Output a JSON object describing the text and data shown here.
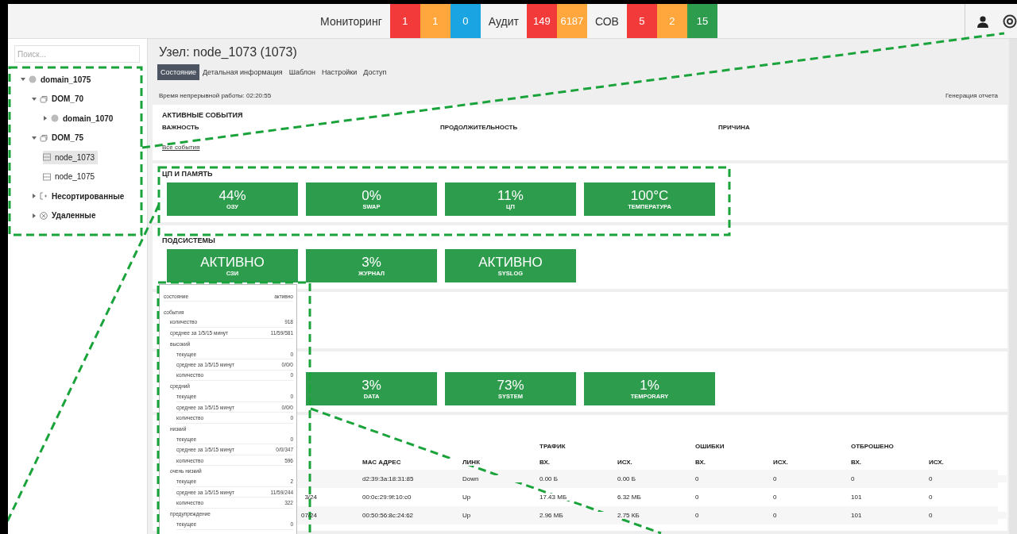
{
  "topbar": {
    "groups": [
      {
        "label": "Мониторинг",
        "counters": [
          {
            "value": "1",
            "color": "#f23a3a"
          },
          {
            "value": "1",
            "color": "#ffa63c"
          },
          {
            "value": "0",
            "color": "#1ba4e2"
          }
        ]
      },
      {
        "label": "Аудит",
        "counters": [
          {
            "value": "149",
            "color": "#f23a3a"
          },
          {
            "value": "6187",
            "color": "#ffa63c"
          }
        ]
      },
      {
        "label": "СОВ",
        "counters": [
          {
            "value": "5",
            "color": "#f23a3a"
          },
          {
            "value": "2",
            "color": "#ffa63c"
          },
          {
            "value": "15",
            "color": "#2e9c4d"
          }
        ]
      }
    ]
  },
  "sidebar": {
    "search": {
      "placeholder": "Поиск..."
    },
    "tree": [
      {
        "label": "domain_1075",
        "kind": "domain",
        "expanded": true,
        "selected": false,
        "children": [
          {
            "label": "DOM_70",
            "kind": "group",
            "expanded": true,
            "selected": false,
            "children": [
              {
                "label": "domain_1070",
                "kind": "domain",
                "expanded": false,
                "selected": false
              }
            ]
          },
          {
            "label": "DOM_75",
            "kind": "group",
            "expanded": true,
            "selected": false,
            "children": [
              {
                "label": "node_1073",
                "kind": "node",
                "selected": true
              },
              {
                "label": "node_1075",
                "kind": "node",
                "selected": false
              }
            ]
          },
          {
            "label": "Несортированные",
            "kind": "unsorted",
            "expanded": false,
            "selected": false
          },
          {
            "label": "Удаленные",
            "kind": "deleted",
            "expanded": false,
            "selected": false
          }
        ]
      }
    ]
  },
  "page": {
    "title": "Узел: node_1073 (1073)",
    "tabs": [
      {
        "label": "Состояние",
        "selected": true
      },
      {
        "label": "Детальная информация",
        "selected": false
      },
      {
        "label": "Шаблон",
        "selected": false
      },
      {
        "label": "Настройки",
        "selected": false
      },
      {
        "label": "Доступ",
        "selected": false
      }
    ],
    "uptime": "Время непрерывной работы: 02:20:55",
    "report_link": "Генерация отчета",
    "active_events": {
      "title": "АКТИВНЫЕ СОБЫТИЯ",
      "columns": [
        "ВАЖНОСТЬ",
        "ПРОДОЛЖИТЕЛЬНОСТЬ",
        "ПРИЧИНА"
      ],
      "link": "Все события"
    },
    "cpu_memory": {
      "title": "ЦП И ПАМЯТЬ",
      "tiles": [
        {
          "value": "44%",
          "label": "ОЗУ"
        },
        {
          "value": "0%",
          "label": "SWAP"
        },
        {
          "value": "11%",
          "label": "ЦП"
        },
        {
          "value": "100°C",
          "label": "ТЕМПЕРАТУРА"
        }
      ]
    },
    "subsystems": {
      "title": "ПОДСИСТЕМЫ",
      "tiles": [
        {
          "value": "АКТИВНО",
          "label": "СЗИ"
        },
        {
          "value": "3%",
          "label": "ЖУРНАЛ"
        },
        {
          "value": "АКТИВНО",
          "label": "SYSLOG"
        }
      ]
    },
    "disks": {
      "tiles": [
        {
          "value": "3%",
          "label": "DATA"
        },
        {
          "value": "73%",
          "label": "SYSTEM"
        },
        {
          "value": "1%",
          "label": "TEMPORARY"
        }
      ]
    },
    "network": {
      "groups": [
        "ТРАФИК",
        "ОШИБКИ",
        "ОТБРОШЕНО"
      ],
      "columns": [
        "МАС АДРЕС",
        "ЛИНК",
        "ВХ.",
        "ИСХ.",
        "ВХ.",
        "ИСХ.",
        "ВХ.",
        "ИСХ."
      ],
      "rows": [
        {
          "cells": [
            "d2:39:3a:18:31:85",
            "Down",
            "0.00 Б",
            "0.00 Б",
            "0",
            "0",
            "0",
            "0"
          ]
        },
        {
          "address_tail": "3/24",
          "cells": [
            "00:0c:29:9f:10:c0",
            "Up",
            "17.43 МБ",
            "6.32 МБ",
            "0",
            "0",
            "101",
            "0"
          ]
        },
        {
          "address_tail": "07/24",
          "cells": [
            "00:50:56:8c:24:62",
            "Up",
            "2.96 МБ",
            "2.75 КБ",
            "0",
            "0",
            "101",
            "0"
          ]
        }
      ]
    }
  },
  "tooltip": {
    "rows": [
      {
        "label": "состояние",
        "value": "активно"
      },
      {
        "label": "события",
        "children": [
          {
            "label": "количество",
            "value": "918"
          },
          {
            "label": "среднее за 1/5/15 минут",
            "value": "11/59/581"
          },
          {
            "label": "высокий",
            "children": [
              {
                "label": "текущее",
                "value": "0"
              },
              {
                "label": "среднее за 1/5/15 минут",
                "value": "0/0/0"
              },
              {
                "label": "количество",
                "value": "0"
              }
            ]
          },
          {
            "label": "средний",
            "children": [
              {
                "label": "текущее",
                "value": "0"
              },
              {
                "label": "среднее за 1/5/15 минут",
                "value": "0/0/0"
              },
              {
                "label": "количество",
                "value": "0"
              }
            ]
          },
          {
            "label": "низкий",
            "children": [
              {
                "label": "текущее",
                "value": "0"
              },
              {
                "label": "среднее за 1/5/15 минут",
                "value": "0/0/347"
              },
              {
                "label": "количество",
                "value": "596"
              }
            ]
          },
          {
            "label": "очень низкий",
            "children": [
              {
                "label": "текущее",
                "value": "2"
              },
              {
                "label": "среднее за 1/5/15 минут",
                "value": "11/59/244"
              },
              {
                "label": "количество",
                "value": "322"
              }
            ]
          },
          {
            "label": "предупреждение",
            "children": [
              {
                "label": "текущее",
                "value": "0"
              }
            ]
          }
        ]
      }
    ]
  }
}
